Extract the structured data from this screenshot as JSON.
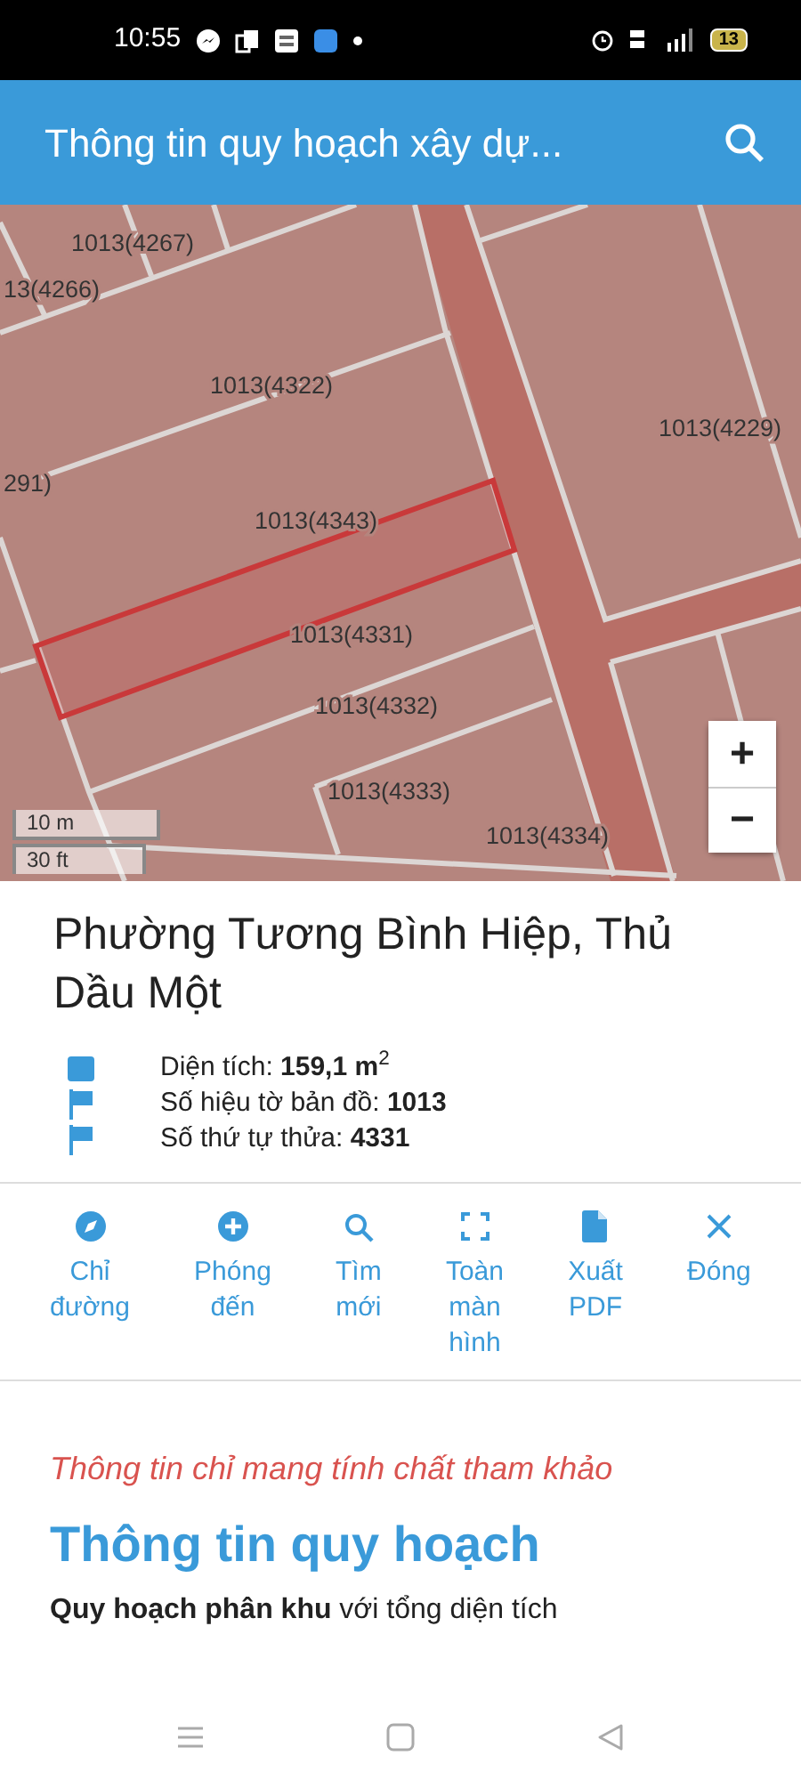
{
  "status_bar": {
    "time": "10:55",
    "battery": "13"
  },
  "app_bar": {
    "title": "Thông tin quy hoạch xây dự..."
  },
  "map": {
    "parcel_labels": [
      "1013(4267)",
      "13(4266)",
      "1013(4322)",
      "1013(4229)",
      "291)",
      "1013(4343)",
      "1013(4331)",
      "1013(4332)",
      "1013(4333)",
      "1013(4334)"
    ],
    "zoom_buttons": [
      "+",
      "−"
    ],
    "scale": [
      "10 m",
      "30 ft"
    ]
  },
  "parcel": {
    "title": "Phường Tương Bình Hiệp, Thủ Dầu Một",
    "attributes": [
      {
        "kind": "square",
        "text": "Diện tích: **159,1 m**$^{2}$"
      },
      {
        "kind": "flag",
        "text": "Số hiệu tờ bản đồ: **1013**"
      },
      {
        "kind": "flag",
        "text": "Số thứ tự thửa: **4331**"
      }
    ]
  },
  "actions": [
    {
      "kind": "directions",
      "label": "Chỉ đường"
    },
    {
      "kind": "zoom",
      "label": "Phóng đến"
    },
    {
      "kind": "search",
      "label": "Tìm mới"
    },
    {
      "kind": "fullscreen",
      "label": "Toàn màn hình"
    },
    {
      "kind": "pdf",
      "label": "Xuất PDF"
    },
    {
      "kind": "close",
      "label": "Đóng"
    }
  ],
  "notice": "Thông tin chỉ mang tính chất tham khảo",
  "section": {
    "heading": "Thông tin quy hoạch",
    "paragraph": "**Quy hoạch phân khu** với tổng diện tích"
  }
}
